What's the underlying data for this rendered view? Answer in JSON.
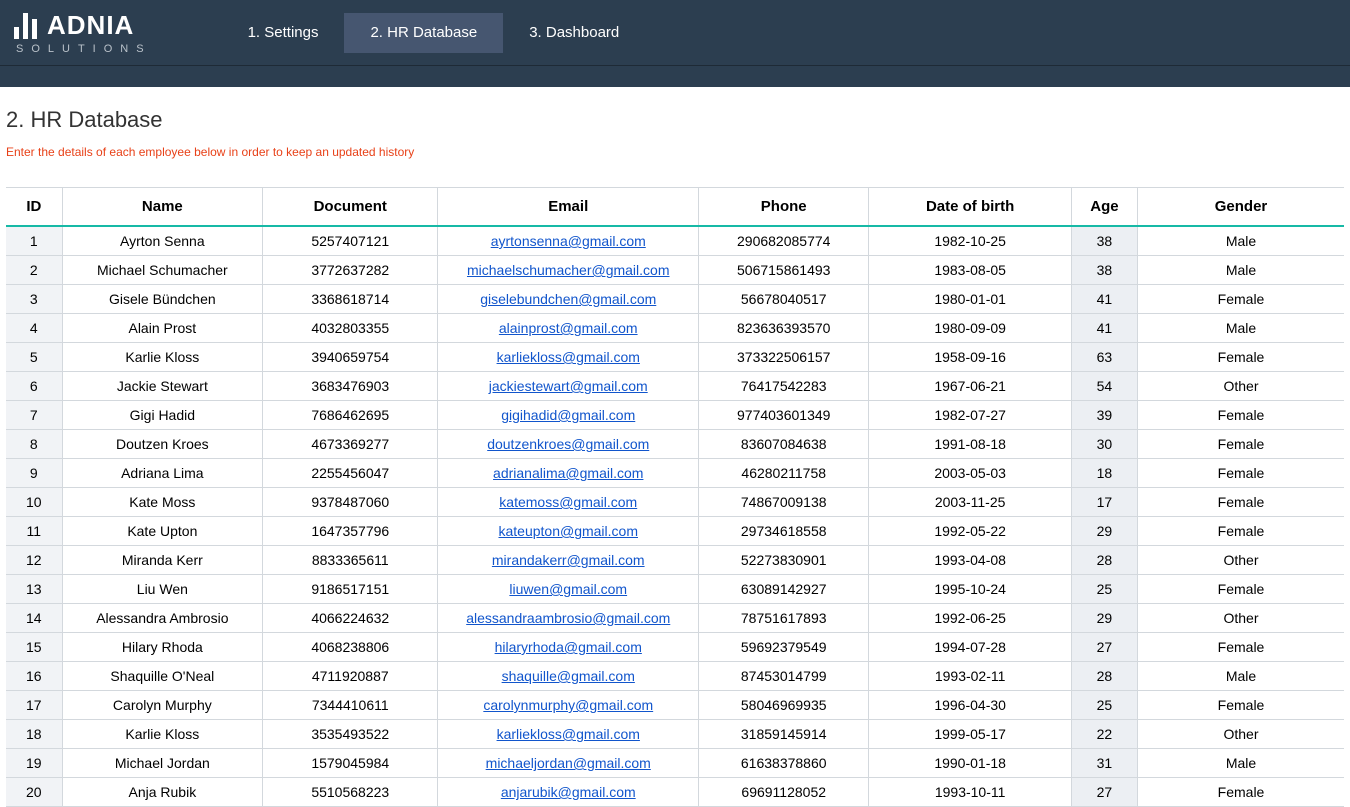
{
  "logo": {
    "brand": "ADNIA",
    "sub": "SOLUTIONS"
  },
  "tabs": [
    {
      "label": "1. Settings",
      "active": false
    },
    {
      "label": "2. HR Database",
      "active": true
    },
    {
      "label": "3. Dashboard",
      "active": false
    }
  ],
  "section": {
    "title": "2. HR Database",
    "hint": "Enter the details of each employee below in order to keep an updated history"
  },
  "table": {
    "headers": {
      "id": "ID",
      "name": "Name",
      "document": "Document",
      "email": "Email",
      "phone": "Phone",
      "dob": "Date of birth",
      "age": "Age",
      "gender": "Gender"
    },
    "rows": [
      {
        "id": "1",
        "name": "Ayrton Senna",
        "document": "5257407121",
        "email": "ayrtonsenna@gmail.com",
        "phone": "290682085774",
        "dob": "1982-10-25",
        "age": "38",
        "gender": "Male"
      },
      {
        "id": "2",
        "name": "Michael Schumacher",
        "document": "3772637282",
        "email": "michaelschumacher@gmail.com",
        "phone": "506715861493",
        "dob": "1983-08-05",
        "age": "38",
        "gender": "Male"
      },
      {
        "id": "3",
        "name": "Gisele Bündchen",
        "document": "3368618714",
        "email": "giselebundchen@gmail.com",
        "phone": "56678040517",
        "dob": "1980-01-01",
        "age": "41",
        "gender": "Female"
      },
      {
        "id": "4",
        "name": "Alain Prost",
        "document": "4032803355",
        "email": "alainprost@gmail.com",
        "phone": "823636393570",
        "dob": "1980-09-09",
        "age": "41",
        "gender": "Male"
      },
      {
        "id": "5",
        "name": "Karlie Kloss",
        "document": "3940659754",
        "email": "karliekloss@gmail.com",
        "phone": "373322506157",
        "dob": "1958-09-16",
        "age": "63",
        "gender": "Female"
      },
      {
        "id": "6",
        "name": "Jackie Stewart",
        "document": "3683476903",
        "email": "jackiestewart@gmail.com",
        "phone": "76417542283",
        "dob": "1967-06-21",
        "age": "54",
        "gender": "Other"
      },
      {
        "id": "7",
        "name": "Gigi Hadid",
        "document": "7686462695",
        "email": "gigihadid@gmail.com",
        "phone": "977403601349",
        "dob": "1982-07-27",
        "age": "39",
        "gender": "Female"
      },
      {
        "id": "8",
        "name": "Doutzen Kroes",
        "document": "4673369277",
        "email": "doutzenkroes@gmail.com",
        "phone": "83607084638",
        "dob": "1991-08-18",
        "age": "30",
        "gender": "Female"
      },
      {
        "id": "9",
        "name": "Adriana Lima",
        "document": "2255456047",
        "email": "adrianalima@gmail.com",
        "phone": "46280211758",
        "dob": "2003-05-03",
        "age": "18",
        "gender": "Female"
      },
      {
        "id": "10",
        "name": "Kate Moss",
        "document": "9378487060",
        "email": "katemoss@gmail.com",
        "phone": "74867009138",
        "dob": "2003-11-25",
        "age": "17",
        "gender": "Female"
      },
      {
        "id": "11",
        "name": "Kate Upton",
        "document": "1647357796",
        "email": "kateupton@gmail.com",
        "phone": "29734618558",
        "dob": "1992-05-22",
        "age": "29",
        "gender": "Female"
      },
      {
        "id": "12",
        "name": "Miranda Kerr",
        "document": "8833365611",
        "email": "mirandakerr@gmail.com",
        "phone": "52273830901",
        "dob": "1993-04-08",
        "age": "28",
        "gender": "Other"
      },
      {
        "id": "13",
        "name": "Liu Wen",
        "document": "9186517151",
        "email": "liuwen@gmail.com",
        "phone": "63089142927",
        "dob": "1995-10-24",
        "age": "25",
        "gender": "Female"
      },
      {
        "id": "14",
        "name": "Alessandra Ambrosio",
        "document": "4066224632",
        "email": "alessandraambrosio@gmail.com",
        "phone": "78751617893",
        "dob": "1992-06-25",
        "age": "29",
        "gender": "Other"
      },
      {
        "id": "15",
        "name": "Hilary Rhoda",
        "document": "4068238806",
        "email": "hilaryrhoda@gmail.com",
        "phone": "59692379549",
        "dob": "1994-07-28",
        "age": "27",
        "gender": "Female"
      },
      {
        "id": "16",
        "name": "Shaquille O'Neal",
        "document": "4711920887",
        "email": "shaquille@gmail.com",
        "phone": "87453014799",
        "dob": "1993-02-11",
        "age": "28",
        "gender": "Male"
      },
      {
        "id": "17",
        "name": "Carolyn Murphy",
        "document": "7344410611",
        "email": "carolynmurphy@gmail.com",
        "phone": "58046969935",
        "dob": "1996-04-30",
        "age": "25",
        "gender": "Female"
      },
      {
        "id": "18",
        "name": "Karlie Kloss",
        "document": "3535493522",
        "email": "karliekloss@gmail.com",
        "phone": "31859145914",
        "dob": "1999-05-17",
        "age": "22",
        "gender": "Other"
      },
      {
        "id": "19",
        "name": "Michael Jordan",
        "document": "1579045984",
        "email": "michaeljordan@gmail.com",
        "phone": "61638378860",
        "dob": "1990-01-18",
        "age": "31",
        "gender": "Male"
      },
      {
        "id": "20",
        "name": "Anja Rubik",
        "document": "5510568223",
        "email": "anjarubik@gmail.com",
        "phone": "69691128052",
        "dob": "1993-10-11",
        "age": "27",
        "gender": "Female"
      }
    ]
  }
}
